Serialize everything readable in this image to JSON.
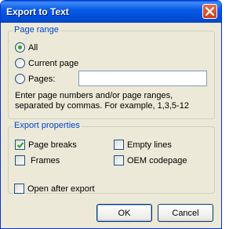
{
  "window": {
    "title": "Export to Text"
  },
  "page_range": {
    "legend": "Page range",
    "options": [
      {
        "label": "All",
        "selected": true
      },
      {
        "label": "Current page",
        "selected": false
      },
      {
        "label": "Pages:",
        "selected": false
      }
    ],
    "pages_input_value": "",
    "hint_line1": "Enter page numbers and/or page ranges,",
    "hint_line2": "separated by commas. For example, 1,3,5-12"
  },
  "export_properties": {
    "legend": "Export properties",
    "page_breaks": {
      "label": "Page breaks",
      "checked": true
    },
    "empty_lines": {
      "label": "Empty lines",
      "checked": false
    },
    "frames": {
      "label": "Frames",
      "checked": false
    },
    "oem_codepage": {
      "label": "OEM codepage",
      "checked": false
    }
  },
  "open_after_export": {
    "label": "Open after export",
    "checked": false
  },
  "buttons": {
    "ok": "OK",
    "cancel": "Cancel"
  }
}
